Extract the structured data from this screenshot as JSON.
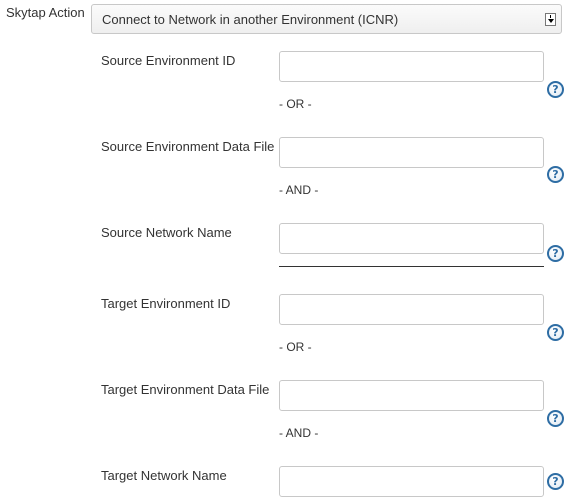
{
  "action": {
    "label": "Skytap Action",
    "selected": "Connect to Network in another Environment (ICNR)"
  },
  "fields": {
    "source_env_id": {
      "label": "Source Environment ID",
      "value": ""
    },
    "source_env_file": {
      "label": "Source Environment Data File",
      "value": ""
    },
    "source_network": {
      "label": "Source Network Name",
      "value": ""
    },
    "target_env_id": {
      "label": "Target Environment ID",
      "value": ""
    },
    "target_env_file": {
      "label": "Target Environment Data File",
      "value": ""
    },
    "target_network": {
      "label": "Target Network Name",
      "value": ""
    }
  },
  "separators": {
    "or_1": "- OR -",
    "and_1": "- AND -",
    "or_2": "- OR -",
    "and_2": "- AND -"
  },
  "help_icon": {
    "glyph": "?",
    "icon": "help-circle-icon",
    "color": "#2e6da4"
  }
}
